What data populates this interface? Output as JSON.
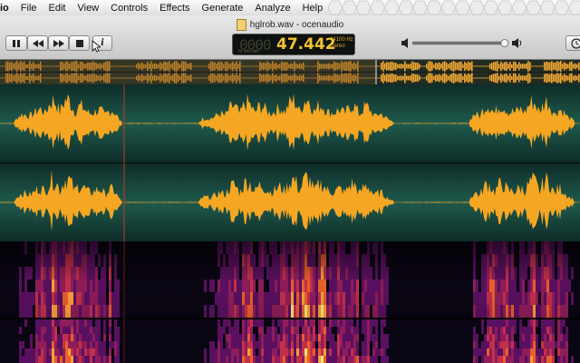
{
  "menu": [
    "io",
    "File",
    "Edit",
    "View",
    "Controls",
    "Effects",
    "Generate",
    "Analyze",
    "Help"
  ],
  "window_title": "hglrob.wav - ocenaudio",
  "time_display": {
    "ghost": "0000",
    "value": "47.442",
    "rate": "44100 Hz",
    "channels": "stereo",
    "units": "hr    min    sec"
  },
  "toolbar": {
    "info_label": "i"
  },
  "volume": {
    "level": 0.96
  },
  "colors": {
    "waveform": "#f5a623",
    "wave_bg": "#17443a",
    "overview_wave": "#d68a1c",
    "cursor": "#c0392b"
  }
}
